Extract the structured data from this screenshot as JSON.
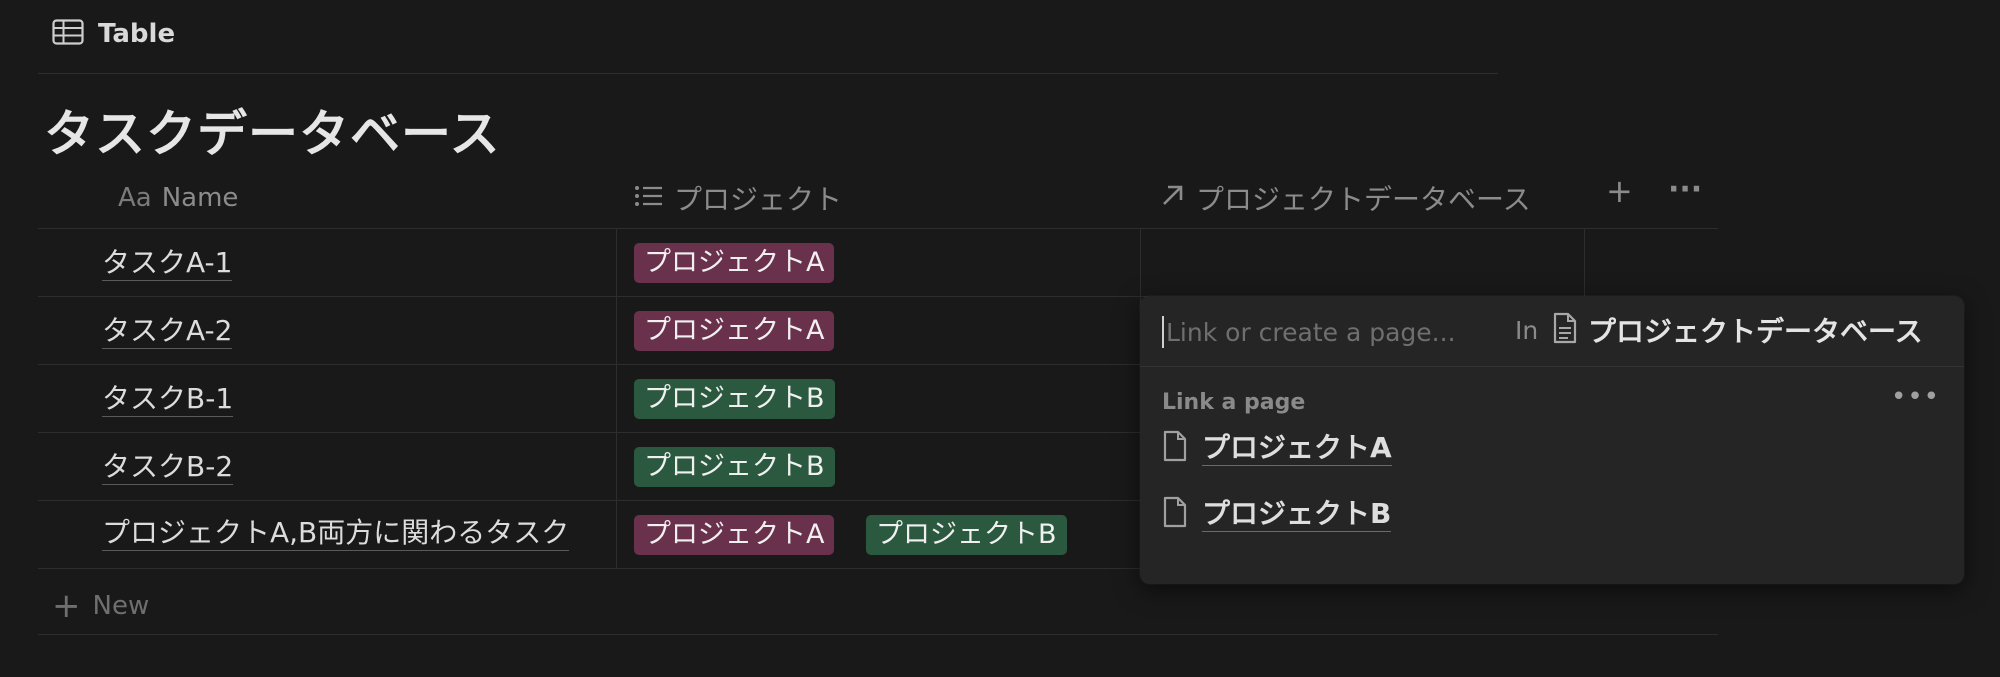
{
  "view": {
    "label": "Table",
    "icon": "table-icon"
  },
  "database": {
    "title": "タスクデータベース"
  },
  "columns": [
    {
      "label": "Name",
      "icon": "Aa"
    },
    {
      "label": "プロジェクト",
      "icon": "list-icon"
    },
    {
      "label": "プロジェクトデータベース",
      "icon": "arrow-up-right-icon"
    }
  ],
  "header_actions": {
    "add": "+",
    "more": "···"
  },
  "rows": [
    {
      "name": "タスクA-1",
      "tags": [
        "プロジェクトA"
      ]
    },
    {
      "name": "タスクA-2",
      "tags": [
        "プロジェクトA"
      ]
    },
    {
      "name": "タスクB-1",
      "tags": [
        "プロジェクトB"
      ]
    },
    {
      "name": "タスクB-2",
      "tags": [
        "プロジェクトB"
      ]
    },
    {
      "name": "プロジェクトA,B両方に関わるタスク",
      "tags": [
        "プロジェクトA",
        "プロジェクトB"
      ]
    }
  ],
  "new_row": {
    "icon": "+",
    "label": "New"
  },
  "tag_colors": {
    "プロジェクトA": "#69314c",
    "プロジェクトB": "#2b593f"
  },
  "popup": {
    "placeholder": "Link or create a page...",
    "in_label": "In",
    "target": "プロジェクトデータベース",
    "section": "Link a page",
    "more": "•••",
    "items": [
      "プロジェクトA",
      "プロジェクトB"
    ]
  }
}
